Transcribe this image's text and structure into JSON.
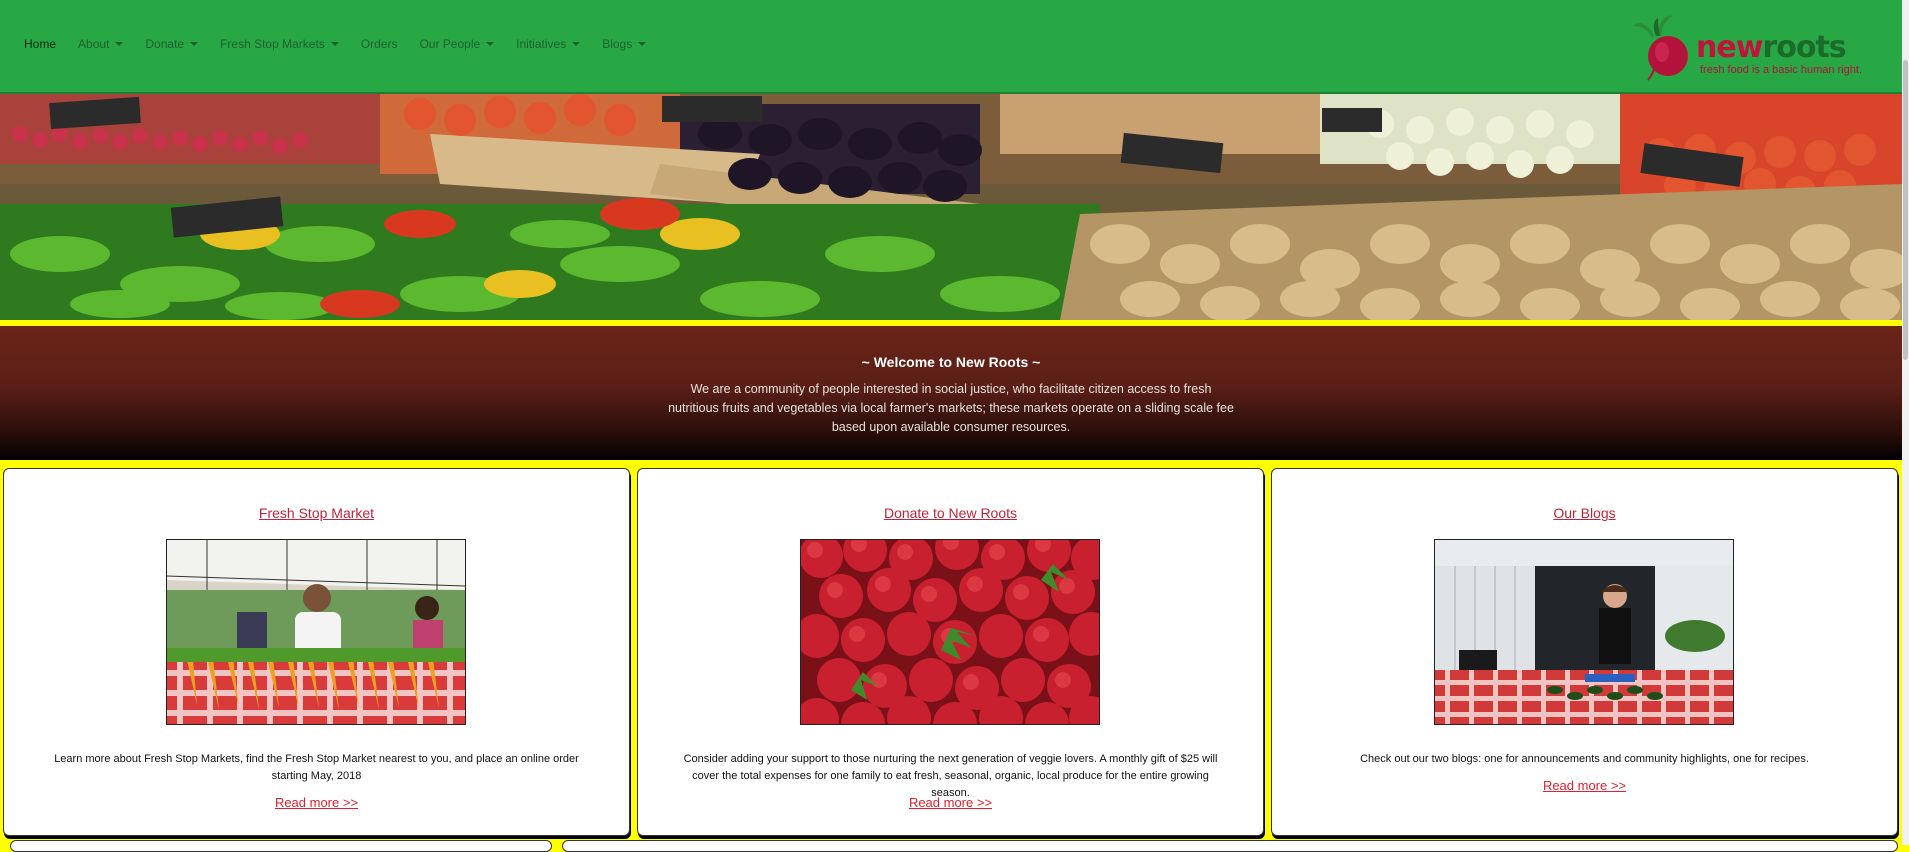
{
  "nav": {
    "items": [
      {
        "label": "Home",
        "dropdown": false
      },
      {
        "label": "About",
        "dropdown": true
      },
      {
        "label": "Donate",
        "dropdown": true
      },
      {
        "label": "Fresh Stop Markets",
        "dropdown": true
      },
      {
        "label": "Orders",
        "dropdown": false
      },
      {
        "label": "Our People",
        "dropdown": true
      },
      {
        "label": "Initiatives",
        "dropdown": true
      },
      {
        "label": "Blogs",
        "dropdown": true
      }
    ],
    "logo": {
      "word_1": "new",
      "word_2": "roots",
      "tagline": "fresh food is a basic human right."
    }
  },
  "welcome": {
    "title": "~ Welcome to New Roots ~",
    "text": "We are a community of people interested in social justice, who facilitate citizen access to fresh nutritious fruits and vegetables via local farmer's markets; these markets operate on a sliding scale fee based upon available consumer resources."
  },
  "cards": [
    {
      "title": "Fresh Stop Market",
      "text": "Learn more about Fresh Stop Markets, find the Fresh Stop Market nearest to you, and place an online order starting May, 2018",
      "link": "Read more >>"
    },
    {
      "title": "Donate to New Roots",
      "text": "Consider adding your support to those nurturing the next generation of veggie lovers. A monthly gift of $25 will cover the total expenses for one family to eat fresh, seasonal, organic, local produce for the entire growing season.",
      "link": "Read more >>"
    },
    {
      "title": "Our Blogs",
      "text": "Check out our two blogs: one for announcements and community highlights, one for recipes.",
      "link": "Read more >>"
    }
  ],
  "colors": {
    "nav_bg": "#28a745",
    "page_bg": "#ffff00",
    "link": "#e0202e",
    "welcome_bg": "#5a1f17"
  },
  "icons": [
    "dropdown-caret-icon",
    "beet-logo-icon"
  ]
}
